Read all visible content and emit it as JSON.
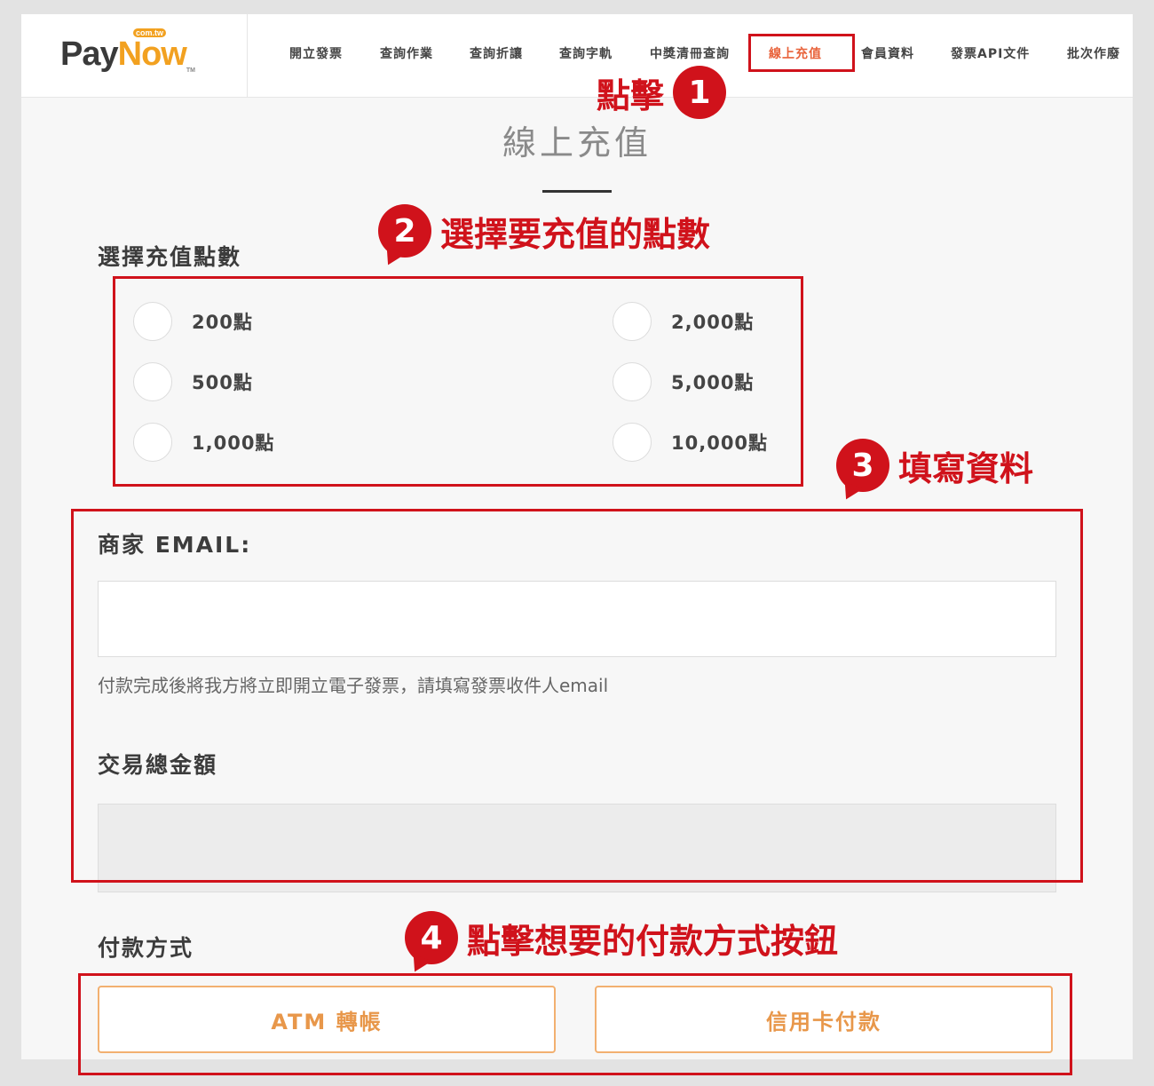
{
  "header": {
    "logo": {
      "pay": "Pay",
      "o": "o",
      "now": "N",
      "tail": "w",
      "comtw": "com.tw",
      "tm": "TM"
    },
    "nav": [
      {
        "label": "開立發票"
      },
      {
        "label": "查詢作業"
      },
      {
        "label": "查詢折讓"
      },
      {
        "label": "查詢字軌"
      },
      {
        "label": "中獎清冊查詢"
      },
      {
        "label": "線上充值",
        "active": true
      },
      {
        "label": "會員資料"
      },
      {
        "label": "發票API文件"
      },
      {
        "label": "批次作廢"
      }
    ]
  },
  "page": {
    "title": "線上充值",
    "points_label": "選擇充值點數",
    "options": [
      {
        "label": "200點"
      },
      {
        "label": "500點"
      },
      {
        "label": "1,000點"
      },
      {
        "label": "2,000點"
      },
      {
        "label": "5,000點"
      },
      {
        "label": "10,000點"
      }
    ],
    "email_label": "商家 EMAIL:",
    "email_value": "",
    "email_hint": "付款完成後將我方將立即開立電子發票，請填寫發票收件人email",
    "amount_label": "交易總金額",
    "amount_value": "",
    "payment_label": "付款方式",
    "atm_button": "ATM 轉帳",
    "card_button": "信用卡付款"
  },
  "annotations": {
    "step1": {
      "number": "1",
      "text": "點擊"
    },
    "step2": {
      "number": "2",
      "text": "選擇要充值的點數"
    },
    "step3": {
      "number": "3",
      "text": "填寫資料"
    },
    "step4": {
      "number": "4",
      "text": "點擊想要的付款方式按鈕"
    },
    "color": "#d0121b"
  },
  "colors": {
    "accent_orange": "#f2a120",
    "nav_active": "#e8623a",
    "button_text": "#e8974a",
    "button_border": "#f2b070"
  }
}
